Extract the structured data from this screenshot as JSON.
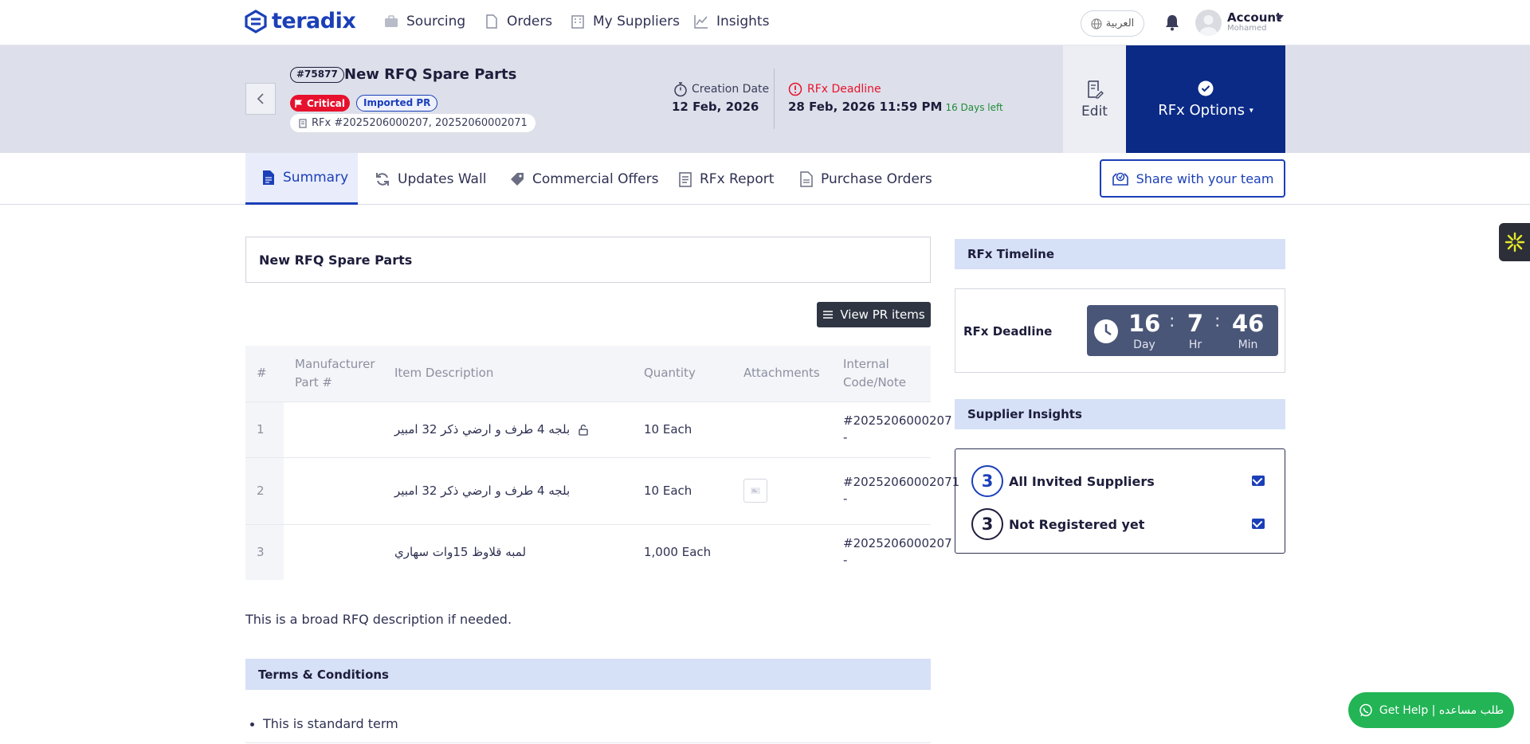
{
  "nav": {
    "brand": "teradix",
    "items": [
      {
        "label": "Sourcing",
        "icon": "briefcase-icon"
      },
      {
        "label": "Orders",
        "icon": "document-icon"
      },
      {
        "label": "My Suppliers",
        "icon": "building-icon"
      },
      {
        "label": "Insights",
        "icon": "chart-line-icon"
      }
    ],
    "language": "العربية",
    "account_label": "Account",
    "account_user": "Mohamed"
  },
  "header": {
    "rfq_id": "#75877",
    "title": "New RFQ Spare Parts",
    "priority": "Critical",
    "badge": "Imported PR",
    "rfx_ref": "RFx #2025206000207, 20252060002071",
    "creation_label": "Creation Date",
    "creation_date": "12 Feb, 2026",
    "deadline_label": "RFx Deadline",
    "deadline": "28 Feb, 2026 11:59 PM",
    "days_left": "16 Days left",
    "edit_label": "Edit",
    "options_label": "RFx Options"
  },
  "tabs": [
    {
      "label": "Summary",
      "active": true
    },
    {
      "label": "Updates Wall",
      "active": false
    },
    {
      "label": "Commercial Offers",
      "active": false
    },
    {
      "label": "RFx Report",
      "active": false
    },
    {
      "label": "Purchase Orders",
      "active": false
    }
  ],
  "share_label": "Share with your team",
  "summary": {
    "title": "New RFQ Spare Parts",
    "view_pr_label": "View PR items",
    "columns": [
      "#",
      "Manufacturer Part #",
      "Item Description",
      "Quantity",
      "Attachments",
      "Internal Code/Note"
    ],
    "rows": [
      {
        "num": "1",
        "part": "",
        "description": "بلجه 4 طرف و ارضي ذكر 32 امبير",
        "quantity": "10 Each",
        "attachment": false,
        "code": "#2025206000207",
        "note": "-"
      },
      {
        "num": "2",
        "part": "",
        "description": "بلجه 4 طرف و ارضي ذكر 32 امبير",
        "quantity": "10 Each",
        "attachment": true,
        "code": "#20252060002071",
        "note": "-"
      },
      {
        "num": "3",
        "part": "",
        "description": "لمبه قلاوظ 15وات سهاري",
        "quantity": "1,000 Each",
        "attachment": false,
        "code": "#2025206000207",
        "note": "-"
      }
    ],
    "description": "This is a broad RFQ description if needed.",
    "terms_title": "Terms & Conditions",
    "terms": [
      "This is standard term"
    ]
  },
  "timeline": {
    "title": "RFx Timeline",
    "deadline_label": "RFx Deadline",
    "days": "16",
    "days_unit": "Day",
    "hours": "7",
    "hours_unit": "Hr",
    "minutes": "46",
    "minutes_unit": "Min"
  },
  "insights": {
    "title": "Supplier Insights",
    "rows": [
      {
        "count": "3",
        "label": "All Invited Suppliers"
      },
      {
        "count": "3",
        "label": "Not Registered yet"
      }
    ]
  },
  "help_label": "Get Help | طلب مساعده",
  "colors": {
    "brand": "#1b3fb8",
    "navy": "#0a2a86",
    "critical": "#e8112d",
    "help": "#22b455"
  }
}
